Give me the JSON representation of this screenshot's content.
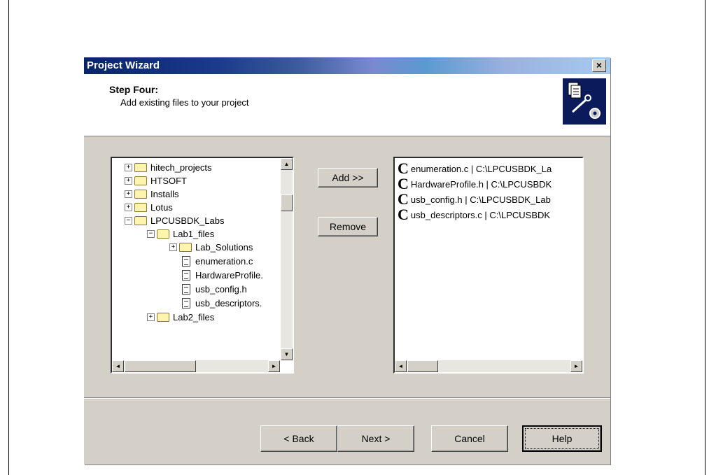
{
  "dialog": {
    "title": "Project Wizard",
    "close_label": "×",
    "step_title": "Step Four:",
    "step_subtitle": "Add existing files to your project"
  },
  "tree": {
    "items": [
      {
        "label": "hitech_projects",
        "expander": "+"
      },
      {
        "label": "HTSOFT",
        "expander": "+"
      },
      {
        "label": "Installs",
        "expander": "+"
      },
      {
        "label": "Lotus",
        "expander": "+"
      },
      {
        "label": "LPCUSBDK_Labs",
        "expander": "−"
      },
      {
        "label": "Lab1_files",
        "expander": "−"
      },
      {
        "label": "Lab_Solutions",
        "expander": "+"
      },
      {
        "label": "enumeration.c"
      },
      {
        "label": "HardwareProfile."
      },
      {
        "label": "usb_config.h"
      },
      {
        "label": "usb_descriptors."
      },
      {
        "label": "Lab2_files",
        "expander": "+"
      }
    ]
  },
  "buttons": {
    "add": "Add >>",
    "remove": "Remove",
    "back": "< Back",
    "next": "Next >",
    "cancel": "Cancel",
    "help": "Help"
  },
  "files": {
    "icon_glyph": "C",
    "items": [
      "enumeration.c | C:\\LPCUSBDK_La",
      "HardwareProfile.h | C:\\LPCUSBDK",
      "usb_config.h | C:\\LPCUSBDK_Lab",
      "usb_descriptors.c | C:\\LPCUSBDK"
    ]
  },
  "scroll": {
    "up_arrow": "▲",
    "down_arrow": "▼",
    "left_arrow": "◄",
    "right_arrow": "►"
  }
}
